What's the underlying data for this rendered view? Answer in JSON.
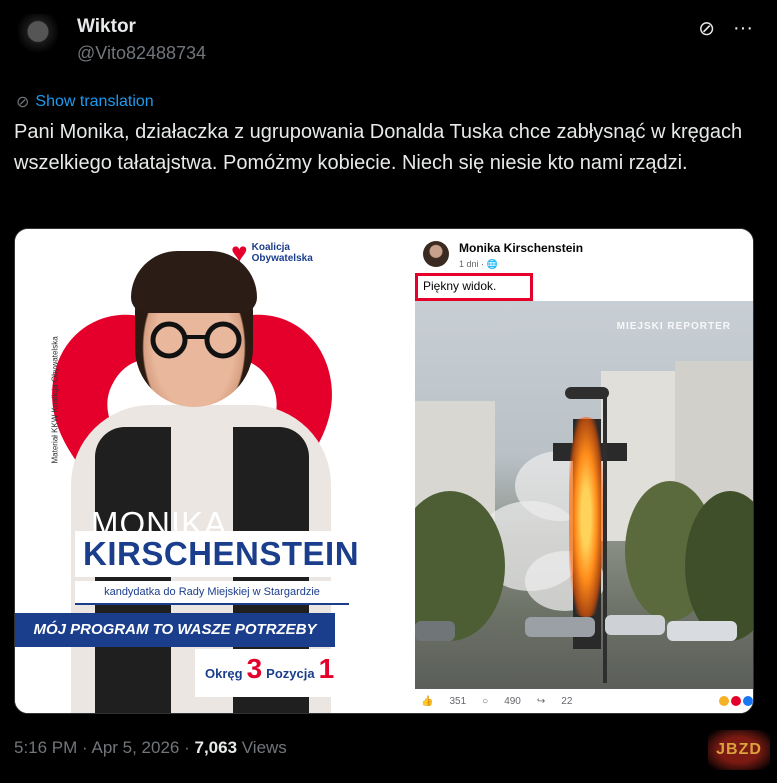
{
  "author": {
    "name": "Wiktor",
    "handle": "@Vito82488734"
  },
  "icons": {
    "grok": "grok-icon",
    "more": "more-icon",
    "translate": "globe-icon"
  },
  "translate_label": "Show translation",
  "tweet_text": "Pani Monika, działaczka z ugrupowania Donalda Tuska chce zabłysnąć w kręgach wszelkiego tałatajstwa. Pomóżmy kobiecie. Niech się niesie kto nami rządzi.",
  "poster": {
    "vertical_text": "Materiał KKW Koalicja Obywatelska",
    "logo_line1": "Koalicja",
    "logo_line2": "Obywatelska",
    "first_name": "MONIKA",
    "last_name": "KIRSCHENSTEIN",
    "subtitle": "kandydatka do Rady Miejskiej w Stargardzie",
    "program": "MÓJ PROGRAM TO WASZE POTRZEBY",
    "district_label": "Okręg",
    "district_num": "3",
    "position_label": "Pozycja",
    "position_num": "1"
  },
  "fb_post": {
    "author": "Monika Kirschenstein",
    "time": "1 dni · 🌐",
    "text": "Piękny widok.",
    "watermark": "MIEJSKI REPORTER",
    "likes": "351",
    "comments": "490",
    "shares": "22"
  },
  "footer": {
    "time": "5:16 PM · Apr 5, 2026 · ",
    "views_count": "7,063",
    "views_label": " Views"
  },
  "watermark_corner": "JBZD",
  "colors": {
    "accent": "#1d9bf0",
    "ko_red": "#e4002b",
    "ko_blue": "#1b3e8c"
  }
}
